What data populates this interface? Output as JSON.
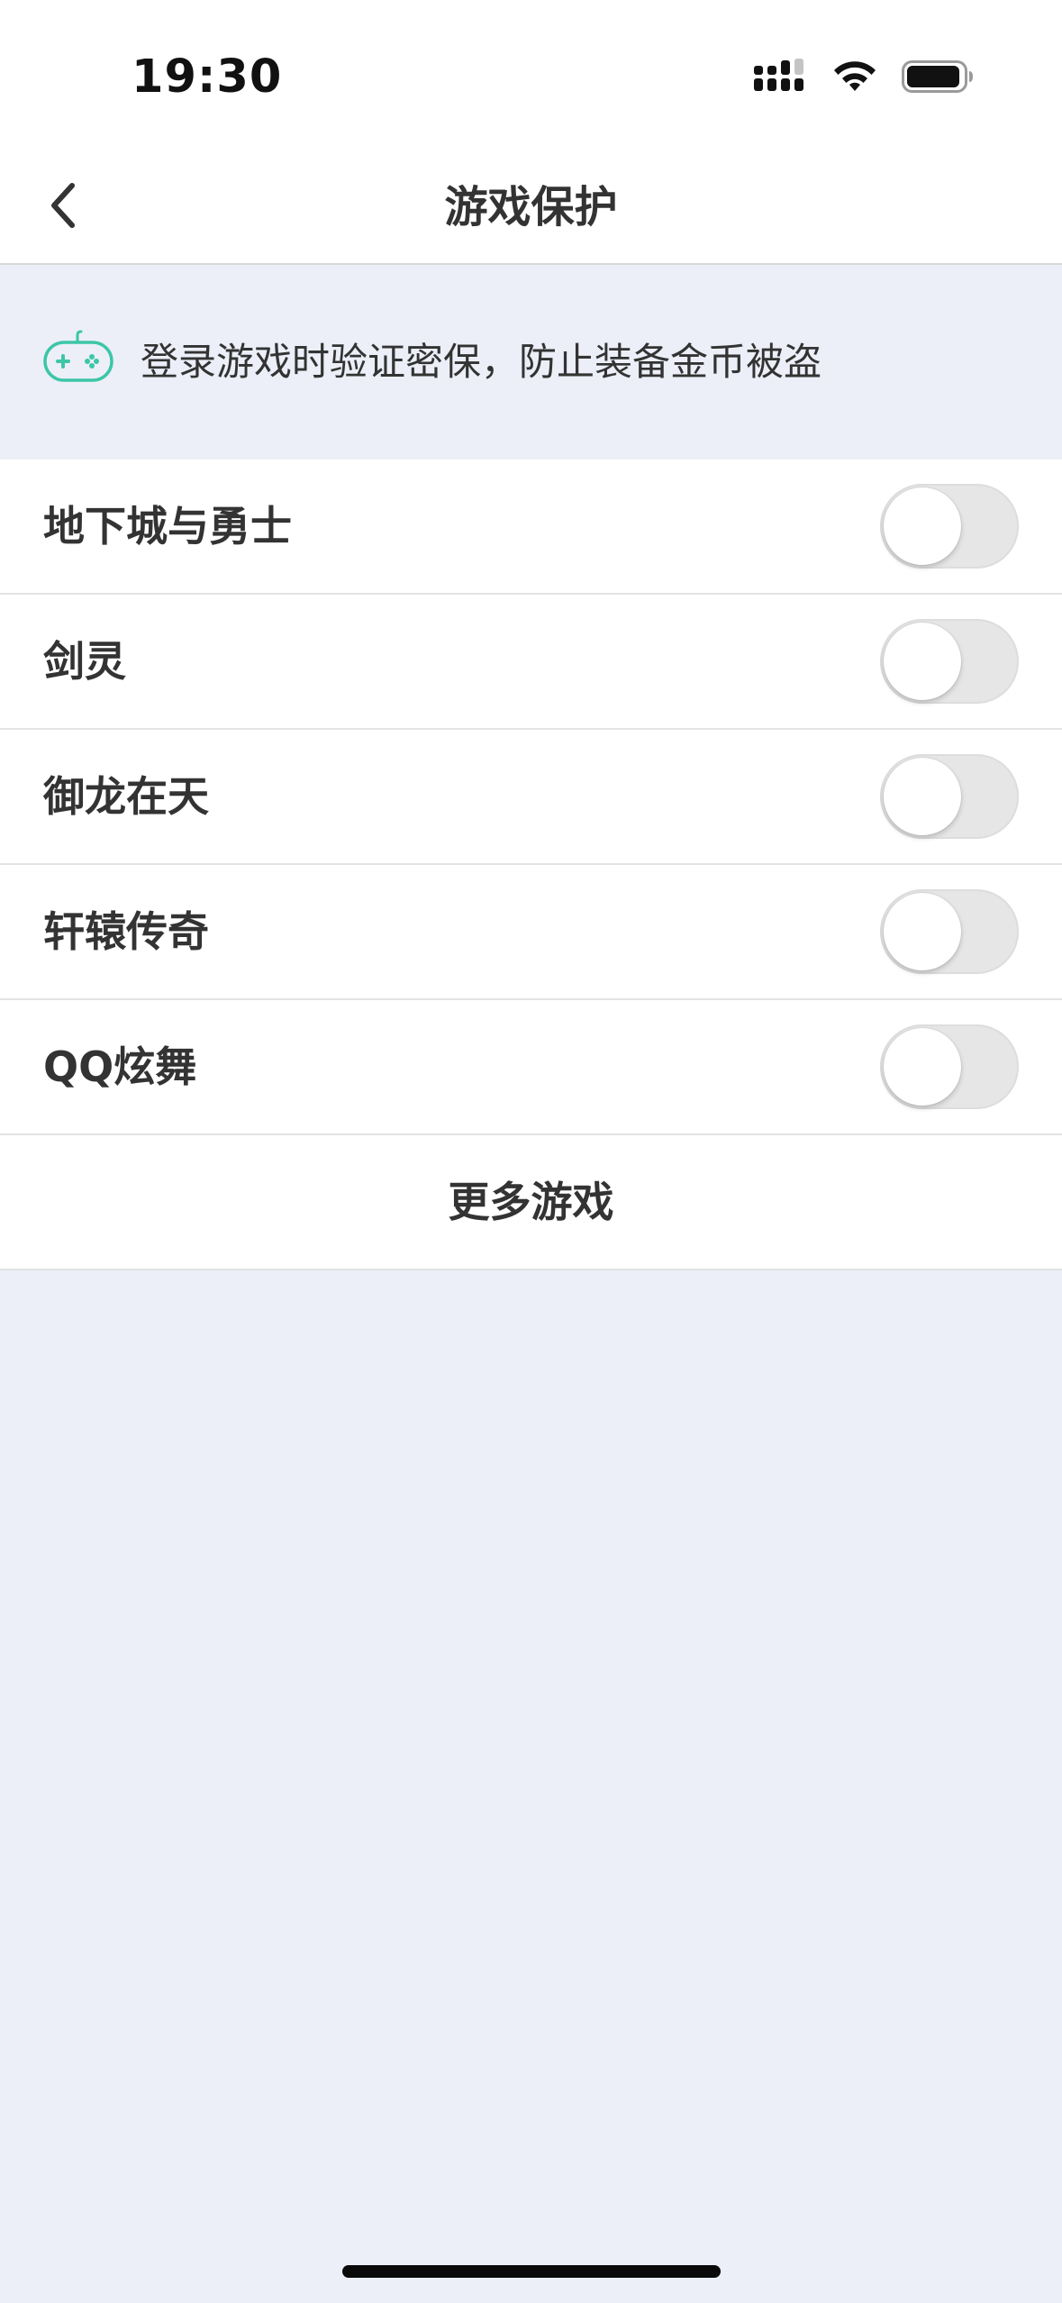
{
  "status_bar": {
    "time": "19:30",
    "signal_icon": "cellular-signal-icon",
    "wifi_icon": "wifi-icon",
    "battery_icon": "battery-icon"
  },
  "nav": {
    "title": "游戏保护",
    "back_icon": "chevron-left-icon"
  },
  "notice": {
    "icon": "gamepad-icon",
    "text": "登录游戏时验证密保，防止装备金币被盗",
    "accent_color": "#3cc6a8"
  },
  "games": [
    {
      "name": "地下城与勇士",
      "enabled": false
    },
    {
      "name": "剑灵",
      "enabled": false
    },
    {
      "name": "御龙在天",
      "enabled": false
    },
    {
      "name": "轩辕传奇",
      "enabled": false
    },
    {
      "name": "QQ炫舞",
      "enabled": false
    }
  ],
  "more_games_label": "更多游戏",
  "colors": {
    "background": "#eceff7",
    "card": "#ffffff",
    "toggle_off": "#e6e6e6"
  }
}
